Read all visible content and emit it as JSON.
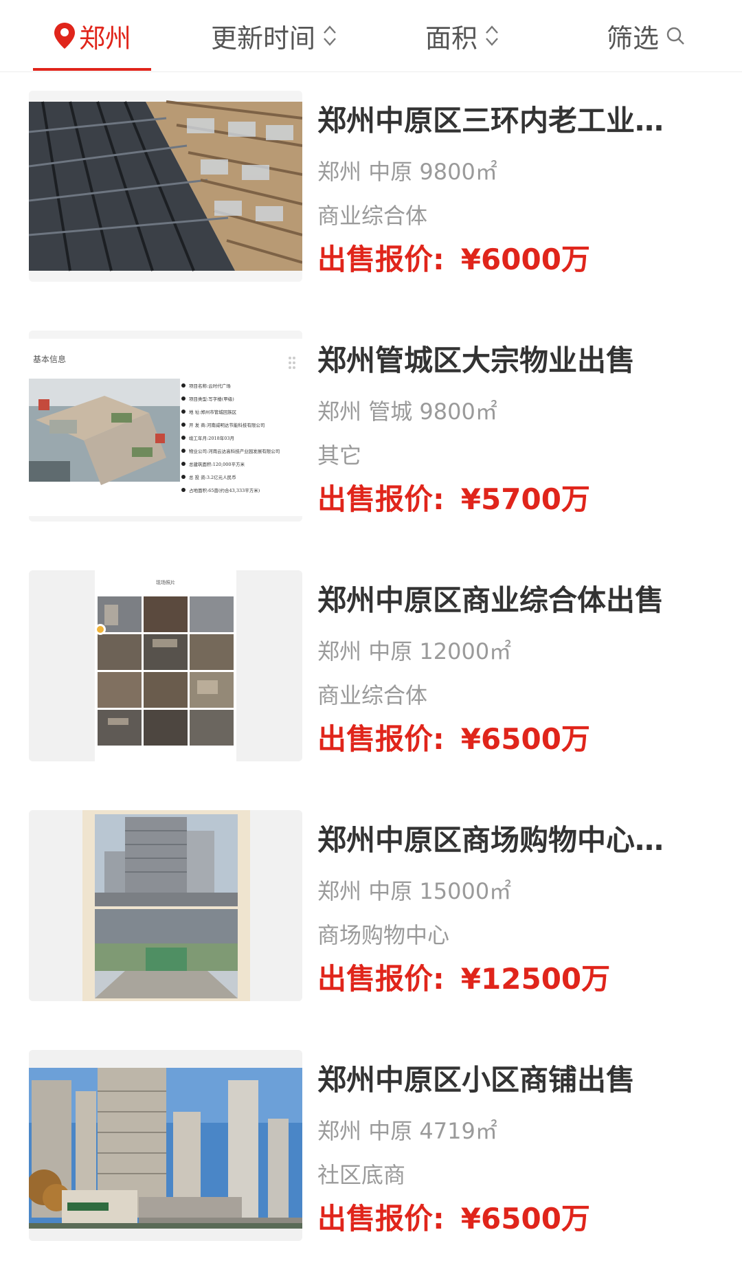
{
  "filter_bar": {
    "city": "郑州",
    "update_time": "更新时间",
    "area": "面积",
    "filter": "筛选"
  },
  "listings": [
    {
      "title": "郑州中原区三环内老工业园区出售",
      "city": "郑州",
      "district": "中原",
      "size": "9800㎡",
      "type": "商业综合体",
      "price_label": "出售报价:",
      "price": "¥6000万"
    },
    {
      "title": "郑州管城区大宗物业出售",
      "city": "郑州",
      "district": "管城",
      "size": "9800㎡",
      "type": "其它",
      "price_label": "出售报价:",
      "price": "¥5700万",
      "thumbnail_text": {
        "heading": "基本信息",
        "rows": [
          "项目名称:云时代广场",
          "项目类型:写字楼(甲级)",
          "地 址:郑州市管城回族区",
          "开 发 商:河南威明达节能科技有限公司",
          "竣工年月:2018年03月",
          "物业公司:河南云达高科技产业园发展有限公司",
          "总建筑面积:120,000平方米",
          "总 投 资:3.2亿元人民币",
          "占地面积:65亩(约合43,333平方米)"
        ]
      }
    },
    {
      "title": "郑州中原区商业综合体出售",
      "city": "郑州",
      "district": "中原",
      "size": "12000㎡",
      "type": "商业综合体",
      "price_label": "出售报价:",
      "price": "¥6500万",
      "thumbnail_text": {
        "heading": "现场照片"
      }
    },
    {
      "title": "郑州中原区商场购物中心出售",
      "city": "郑州",
      "district": "中原",
      "size": "15000㎡",
      "type": "商场购物中心",
      "price_label": "出售报价:",
      "price": "¥12500万"
    },
    {
      "title": "郑州中原区小区商铺出售",
      "city": "郑州",
      "district": "中原",
      "size": "4719㎡",
      "type": "社区底商",
      "price_label": "出售报价:",
      "price": "¥6500万"
    }
  ],
  "colors": {
    "accent": "#e0251b",
    "title": "#333333",
    "meta": "#9a9a9a"
  },
  "icons": [
    "location-pin-icon",
    "sort-icon",
    "search-icon"
  ]
}
